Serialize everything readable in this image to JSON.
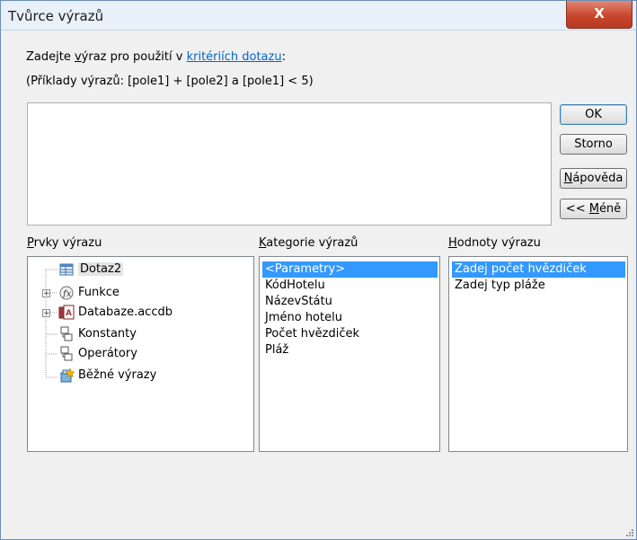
{
  "window": {
    "title": "Tvůrce výrazů",
    "close_label": "X"
  },
  "instruction": {
    "prefix": "Zadejte ",
    "underlined_letter": "v",
    "mid": "ýraz pro použití v ",
    "link": "kritériích dotazu",
    "suffix": ":"
  },
  "examples": "(Příklady výrazů: [pole1] + [pole2] a [pole1] < 5)",
  "expression_value": "",
  "buttons": {
    "ok": "OK",
    "cancel": "Storno",
    "help_key": "N",
    "help_rest": "ápověda",
    "less_prefix": "<< ",
    "less_key": "M",
    "less_rest": "éně"
  },
  "headers": {
    "elements_key": "P",
    "elements_rest": "rvky výrazu",
    "categories_key": "K",
    "categories_rest": "ategorie výrazů",
    "values_key": "H",
    "values_rest": "odnoty výrazu"
  },
  "tree": [
    {
      "label": "Dotaz2",
      "icon": "query-icon",
      "expandable": false
    },
    {
      "label": "Funkce",
      "icon": "function-icon",
      "expandable": true
    },
    {
      "label": "Databaze.accdb",
      "icon": "database-icon",
      "expandable": true
    },
    {
      "label": "Konstanty",
      "icon": "constants-icon",
      "expandable": false
    },
    {
      "label": "Operátory",
      "icon": "operators-icon",
      "expandable": false
    },
    {
      "label": "Běžné výrazy",
      "icon": "common-expressions-icon",
      "expandable": false
    }
  ],
  "categories": [
    "<Parametry>",
    "KódHotelu",
    "NázevStátu",
    "Jméno hotelu",
    "Počet hvězdiček",
    "Pláž"
  ],
  "selected_category": "<Parametry>",
  "values": [
    "Zadej počet hvězdiček",
    "Zadej typ pláže"
  ],
  "selected_value": "Zadej počet hvězdiček",
  "colors": {
    "selection": "#3399ff",
    "link": "#0066cc",
    "close": "#c9452c"
  }
}
